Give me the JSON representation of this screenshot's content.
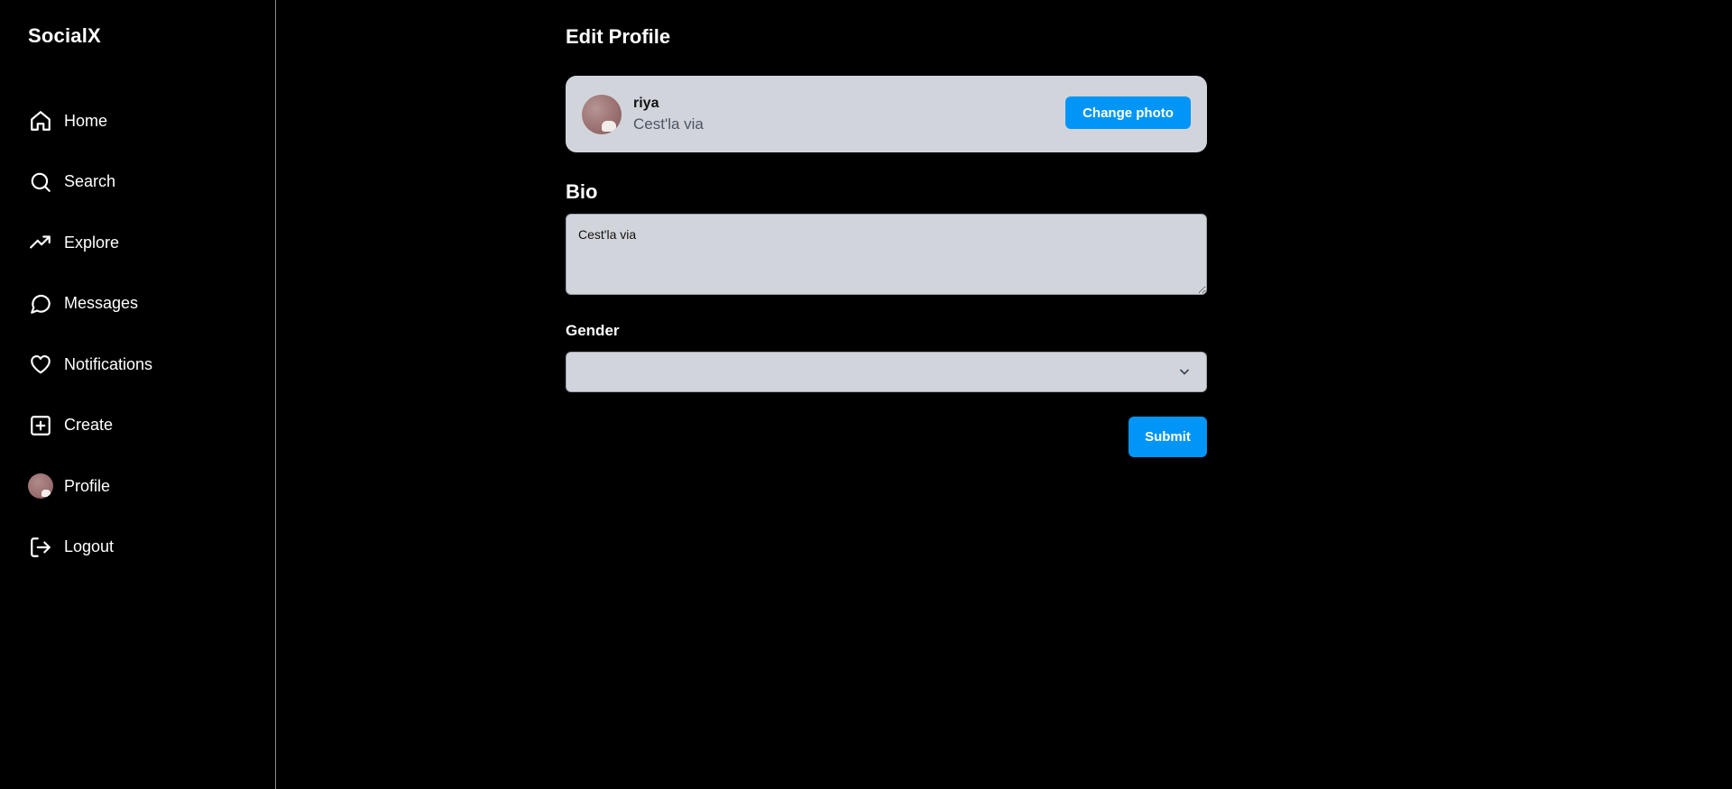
{
  "app": {
    "brand": "SocialX"
  },
  "sidebar": {
    "items": [
      {
        "label": "Home",
        "icon": "home-icon"
      },
      {
        "label": "Search",
        "icon": "search-icon"
      },
      {
        "label": "Explore",
        "icon": "trending-up-icon"
      },
      {
        "label": "Messages",
        "icon": "message-circle-icon"
      },
      {
        "label": "Notifications",
        "icon": "heart-icon"
      },
      {
        "label": "Create",
        "icon": "plus-square-icon"
      },
      {
        "label": "Profile",
        "icon": "avatar"
      },
      {
        "label": "Logout",
        "icon": "logout-icon"
      }
    ]
  },
  "main": {
    "title": "Edit Profile",
    "profile_card": {
      "username": "riya",
      "bio": "Cest'la via",
      "change_photo_label": "Change photo"
    },
    "bio_section": {
      "title": "Bio",
      "value": "Cest'la via"
    },
    "gender_section": {
      "title": "Gender",
      "selected": ""
    },
    "submit_label": "Submit"
  },
  "colors": {
    "background": "#000000",
    "accent": "#0095f6",
    "card": "#d1d5db"
  }
}
